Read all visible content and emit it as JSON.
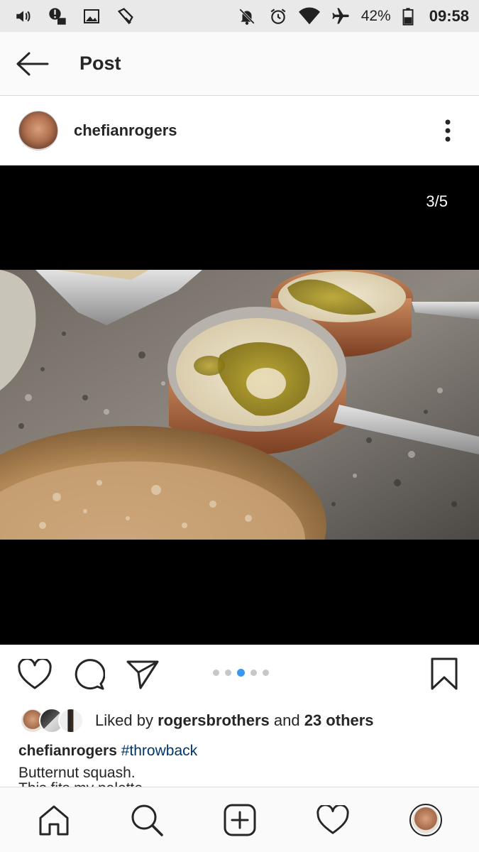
{
  "status_bar": {
    "battery": "42%",
    "time": "09:58",
    "icons": [
      "volume-icon",
      "alert-icon",
      "image-icon",
      "pan-icon",
      "mute-bell-icon",
      "alarm-icon",
      "wifi-icon",
      "airplane-icon",
      "battery-icon"
    ]
  },
  "header": {
    "title": "Post"
  },
  "post": {
    "username": "chefianrogers",
    "counter": "3/5",
    "carousel": {
      "count": 5,
      "active_index": 2
    },
    "likes": {
      "prefix": "Liked by ",
      "first_user": "rogersbrothers",
      "connector": " and ",
      "others": "23 others"
    },
    "caption": {
      "user": "chefianrogers",
      "hashtag": "#throwback",
      "line1": "Butternut squash.",
      "line2": "This fits my palette..."
    }
  },
  "colors": {
    "accent_blue": "#3897f0",
    "hashtag": "#003569",
    "text": "#262626"
  }
}
